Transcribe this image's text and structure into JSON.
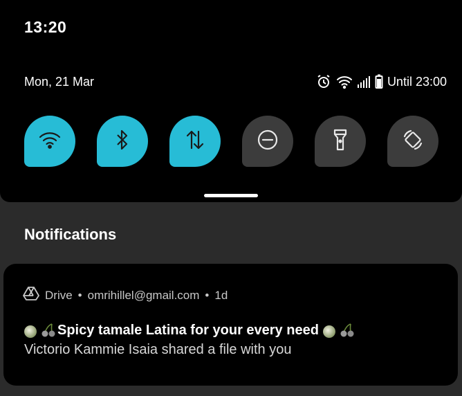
{
  "status": {
    "time": "13:20",
    "date": "Mon, 21 Mar",
    "battery_text": "Until 23:00",
    "icons": [
      "alarm-icon",
      "wifi-icon",
      "signal-icon",
      "battery-icon"
    ]
  },
  "quick_tiles": [
    {
      "name": "wifi",
      "icon": "wifi-icon",
      "active": true
    },
    {
      "name": "bluetooth",
      "icon": "bluetooth-icon",
      "active": true
    },
    {
      "name": "mobile-data",
      "icon": "data-transfer-icon",
      "active": true
    },
    {
      "name": "do-not-disturb",
      "icon": "dnd-icon",
      "active": false
    },
    {
      "name": "flashlight",
      "icon": "flashlight-icon",
      "active": false
    },
    {
      "name": "auto-rotate",
      "icon": "rotate-icon",
      "active": false
    }
  ],
  "colors": {
    "active_tile": "#27bcd6",
    "inactive_tile": "#3c3c3c"
  },
  "notifications": {
    "heading": "Notifications",
    "items": [
      {
        "app": "Drive",
        "account": "omrihillel@gmail.com",
        "age": "1d",
        "title": "Spicy tamale Latina for your every need",
        "text": "Victorio Kammie Isaia shared a file with you"
      }
    ]
  }
}
